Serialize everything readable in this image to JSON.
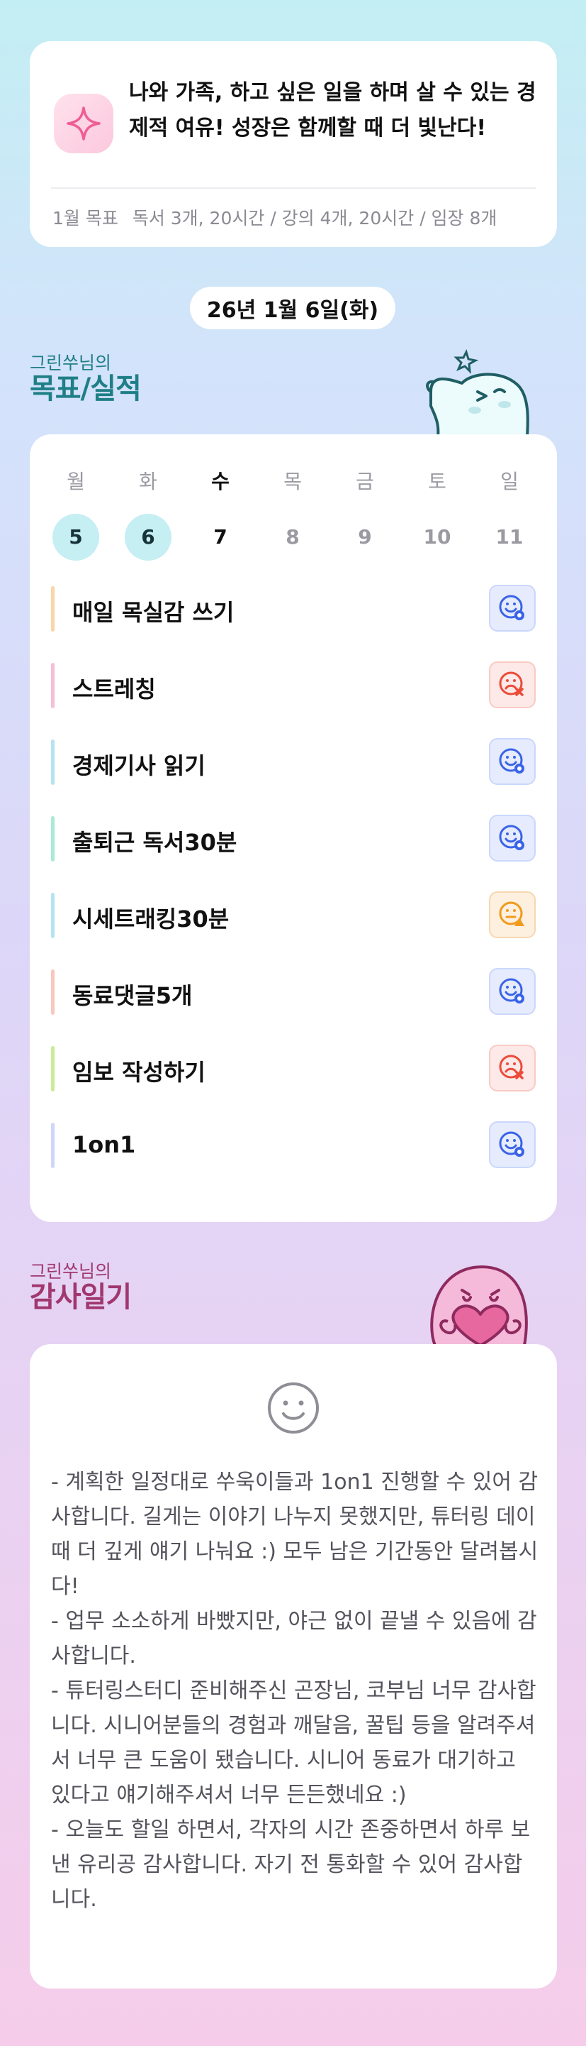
{
  "goal": {
    "icon": "sparkle-icon",
    "text": "나와 가족, 하고 싶은 일을 하며 살 수 있는 경제적 여유! 성장은 함께할 때 더 빛난다!",
    "month_label": "1월 목표",
    "month_value": "독서 3개, 20시간 / 강의 4개, 20시간 / 임장 8개"
  },
  "date": "26년 1월 6일(화)",
  "goals_section": {
    "small": "그린쑤님의",
    "big": "목표/실적"
  },
  "week": [
    {
      "name": "월",
      "num": "5",
      "state": "done"
    },
    {
      "name": "화",
      "num": "6",
      "state": "done"
    },
    {
      "name": "수",
      "num": "7",
      "state": "today"
    },
    {
      "name": "목",
      "num": "8",
      "state": "future"
    },
    {
      "name": "금",
      "num": "9",
      "state": "future"
    },
    {
      "name": "토",
      "num": "10",
      "state": "future"
    },
    {
      "name": "일",
      "num": "11",
      "state": "future"
    }
  ],
  "tasks": [
    {
      "name": "매일 목실감 쓰기",
      "bar": "#f9d6a8",
      "status": "ok",
      "icon": "smile-check-icon"
    },
    {
      "name": "스트레칭",
      "bar": "#f6bfd9",
      "status": "fail",
      "icon": "frown-x-icon"
    },
    {
      "name": "경제기사 읽기",
      "bar": "#b7e3f0",
      "status": "ok",
      "icon": "smile-check-icon"
    },
    {
      "name": "출퇴근 독서30분",
      "bar": "#a9ead7",
      "status": "ok",
      "icon": "smile-check-icon"
    },
    {
      "name": "시세트래킹30분",
      "bar": "#b7e3f0",
      "status": "warn",
      "icon": "neutral-warning-icon"
    },
    {
      "name": "동료댓글5개",
      "bar": "#f9c8bc",
      "status": "ok",
      "icon": "smile-check-icon"
    },
    {
      "name": "임보 작성하기",
      "bar": "#c8ec9a",
      "status": "fail",
      "icon": "frown-x-icon"
    },
    {
      "name": "1on1",
      "bar": "#cfd6f7",
      "status": "ok",
      "icon": "smile-check-icon"
    }
  ],
  "status_colors": {
    "ok": "#3a63e8",
    "fail": "#ec4b3a",
    "warn": "#f29a1c"
  },
  "thanks_section": {
    "small": "그린쑤님의",
    "big": "감사일기"
  },
  "thanks": {
    "icon": "smiley-icon",
    "text": "- 계획한 일정대로 쑤욱이들과 1on1 진행할 수 있어 감사합니다. 길게는 이야기 나누지 못했지만, 튜터링 데이 때 더 깊게 얘기 나눠요 :) 모두 남은 기간동안 달려봅시다!\n- 업무 소소하게 바빴지만, 야근 없이 끝낼 수 있음에 감사합니다.\n- 튜터링스터디 준비해주신 곤장님, 코부님 너무 감사합니다. 시니어분들의 경험과 깨달음, 꿀팁 등을 알려주셔서 너무 큰 도움이 됐습니다. 시니어 동료가 대기하고 있다고 얘기해주셔서 너무 든든했네요 :)\n- 오늘도 할일 하면서, 각자의 시간 존중하면서 하루 보낸 유리공 감사합니다. 자기 전 통화할 수 있어 감사합니다."
  }
}
